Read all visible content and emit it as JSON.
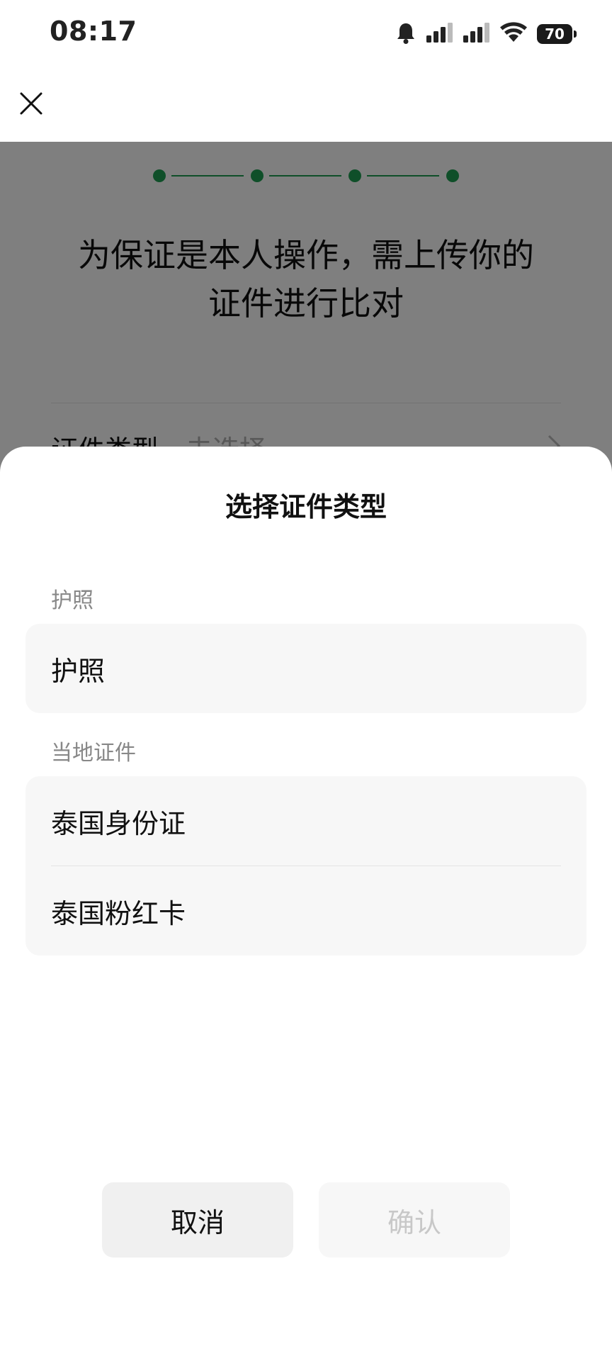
{
  "status_bar": {
    "time": "08:17",
    "battery": "70",
    "icons": [
      "bell-icon",
      "cellular-signal-icon",
      "cellular-signal-icon",
      "wifi-icon",
      "battery-icon"
    ]
  },
  "nav": {
    "close_icon": "close-icon"
  },
  "page": {
    "steps": 4,
    "step_color": "#1e9e52",
    "title_line1": "为保证是本人操作，需上传你的",
    "title_line2": "证件进行比对",
    "id_type_label": "证件类型",
    "id_type_value": "去选择"
  },
  "sheet": {
    "title": "选择证件类型",
    "sections": [
      {
        "label": "护照",
        "options": [
          "护照"
        ]
      },
      {
        "label": "当地证件",
        "options": [
          "泰国身份证",
          "泰国粉红卡"
        ]
      }
    ],
    "cancel_label": "取消",
    "confirm_label": "确认"
  }
}
